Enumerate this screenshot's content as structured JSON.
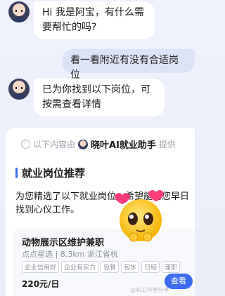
{
  "chat": {
    "bot_greeting": "Hi 我是阿宝，有什么需要帮忙的吗?",
    "user_query": "看一看附近有没有合适岗位",
    "bot_reply": "已为你找到以下岗位，可按需查看详情"
  },
  "result_card": {
    "provider_prefix": "以下内容由",
    "provider_name": "晓叶AI就业助手",
    "provider_suffix": "提供",
    "section_title": "就业岗位推荐",
    "intro": "为您精选了以下就业岗位，希望能助您早日找到心仪工作。",
    "job": {
      "title": "动物展示区维护兼职",
      "meta": "点点星选 | 8.3km 浙江省杭",
      "tags": [
        "企业信用好",
        "企业有实力",
        "包餐",
        "包水",
        "日结",
        "兼职"
      ],
      "salary": "220元/日",
      "view_label": "查看"
    }
  },
  "icons": {
    "emoji_sticker": "pleading-face-with-hearts",
    "provider_info": "info-icon"
  },
  "colors": {
    "accent": "#3b6cf0",
    "bubble_user": "#dde3f7",
    "bubble_bot": "#ffffff"
  },
  "watermark": "@Ai工作室分享"
}
